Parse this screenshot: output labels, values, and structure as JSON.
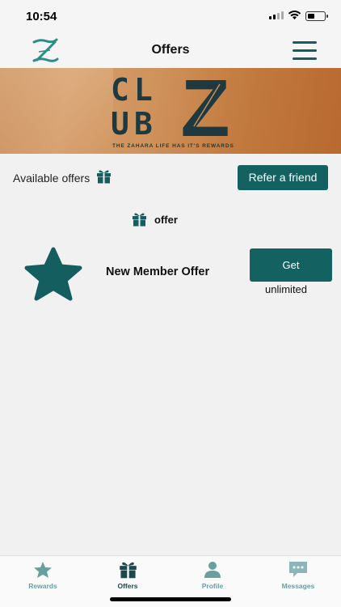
{
  "status_bar": {
    "time": "10:54"
  },
  "header": {
    "title": "Offers"
  },
  "banner": {
    "line1": "CL",
    "line2": "UB",
    "logo_letter": "Z",
    "tagline": "THE ZAHARA LIFE HAS IT'S REWARDS"
  },
  "offers_page": {
    "available_label": "Available offers",
    "refer_button": "Refer a friend",
    "section_label": "offer",
    "offer_name": "New Member Offer",
    "get_button": "Get",
    "limit": "unlimited"
  },
  "tabs": [
    {
      "label": "Rewards",
      "icon": "star-icon"
    },
    {
      "label": "Offers",
      "icon": "gift-icon"
    },
    {
      "label": "Profile",
      "icon": "user-icon"
    },
    {
      "label": "Messages",
      "icon": "chat-icon"
    }
  ],
  "colors": {
    "accent": "#146162",
    "inactive_tab": "#6a9fa0"
  }
}
